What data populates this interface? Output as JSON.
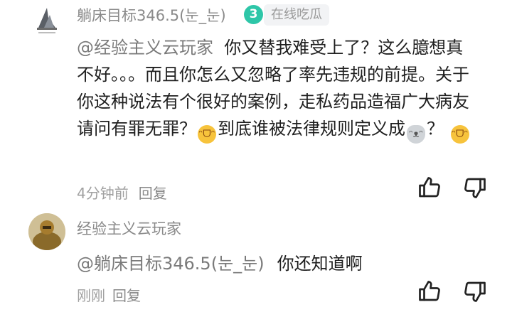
{
  "comments": [
    {
      "username": "躺床目标346.5(눈_눈)",
      "badge_icon": "3",
      "badge": "在线吃瓜",
      "mention": "@经验主义云玩家",
      "text_part1": "你又替我难受上了？这么臆想真不好。。。而且你怎么又忽略了率先违规的前提。关于你这种说法有个很好的案例，走私药品造福广大病友请问有罪无罪？",
      "text_part2": "到底谁被法律规则定义成",
      "text_part3": "？",
      "time": "4分钟前",
      "reply_label": "回复",
      "icons": [
        "laughing-emoji-icon",
        "mouse-emoji-icon",
        "laughing-emoji-icon",
        "thumb-up-icon",
        "thumb-down-icon"
      ]
    },
    {
      "username": "经验主义云玩家",
      "mention": "@躺床目标346.5(눈_눈)",
      "text": "你还知道啊",
      "time": "刚刚",
      "reply_label": "回复",
      "icons": [
        "thumb-up-icon",
        "thumb-down-icon"
      ]
    }
  ],
  "colors": {
    "badge_teal": "#2ec6a8",
    "text": "#1f1f1f",
    "muted": "#8a8a8a"
  }
}
